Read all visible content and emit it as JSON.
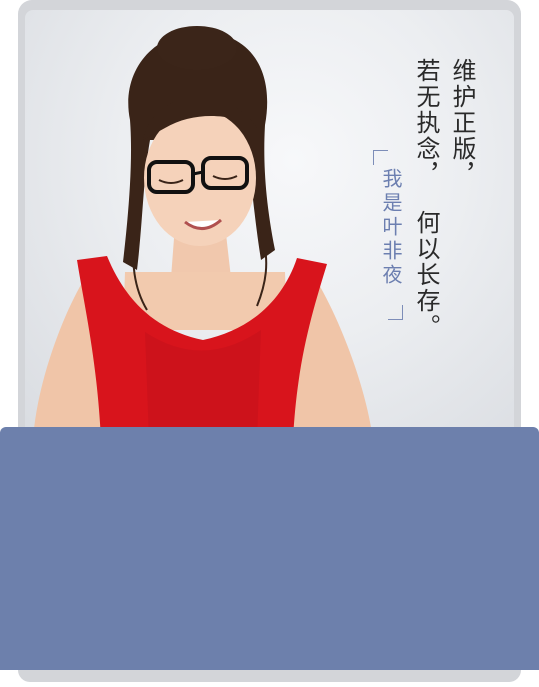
{
  "poem": {
    "line1": "维护正版，",
    "line2": "若无执念，",
    "line3": "何以长存。"
  },
  "brand": {
    "text": "我是叶非夜"
  },
  "colors": {
    "panel": "#6d80ac",
    "frame": "#d3d5d9",
    "brand_accent": "#6c7fb0",
    "dress": "#d8141c"
  }
}
